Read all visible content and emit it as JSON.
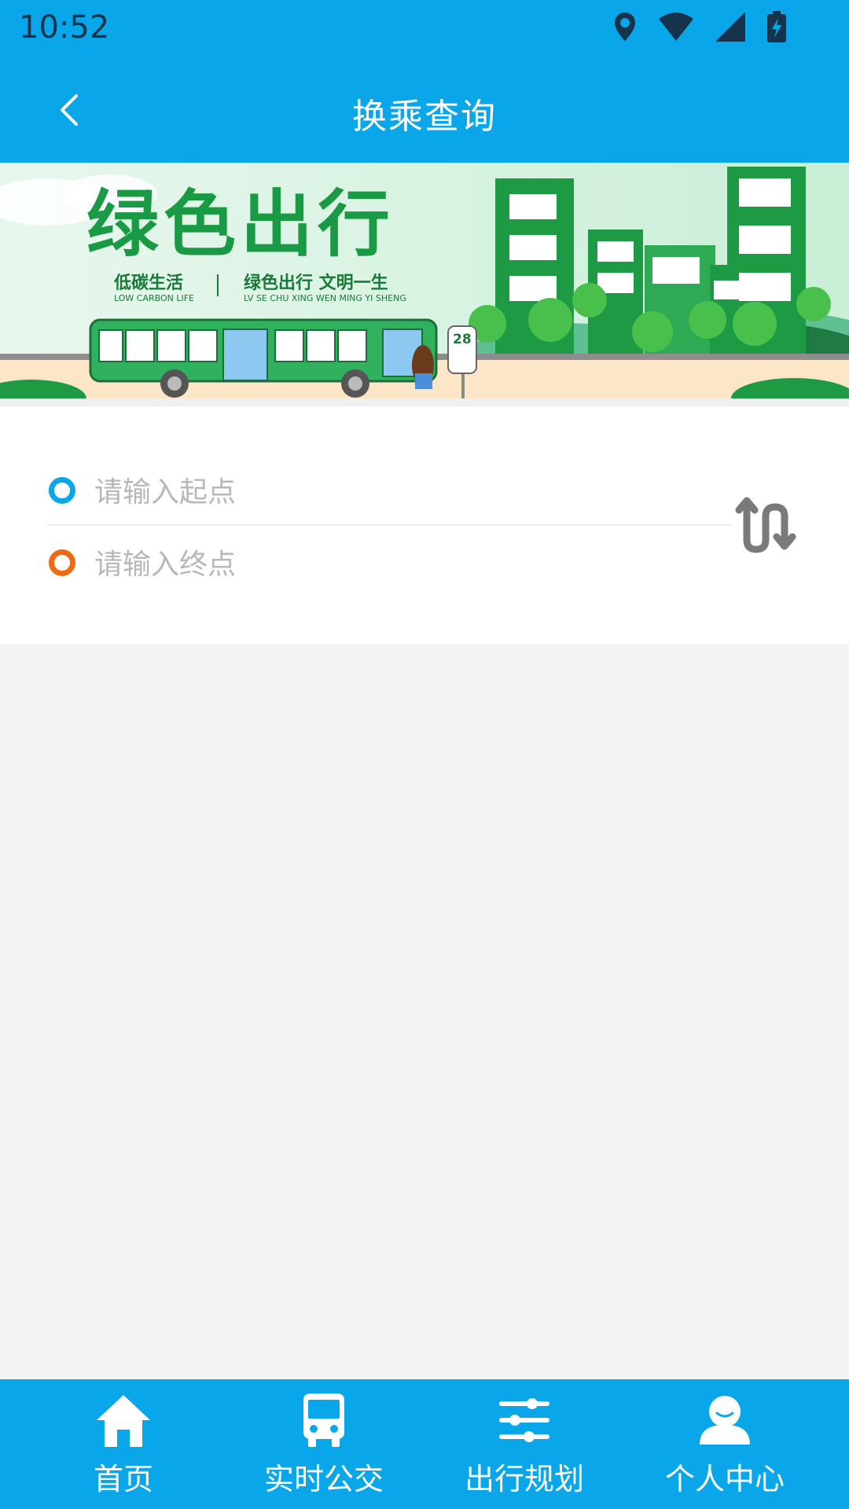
{
  "status_bar": {
    "time": "10:52",
    "icons": [
      "location-icon",
      "wifi-icon",
      "signal-icon",
      "battery-charging-icon"
    ]
  },
  "header": {
    "title": "换乘查询",
    "back_icon": "chevron-left-icon"
  },
  "banner": {
    "title": "绿色出行",
    "slogan_cn_left": "低碳生活",
    "slogan_cn_right": "绿色出行 文明一生",
    "slogan_en_left": "LOW CARBON LIFE",
    "slogan_en_right": "LV SE CHU XING  WEN MING YI SHENG",
    "bus_stop_number": "28"
  },
  "route_form": {
    "start_placeholder": "请输入起点",
    "end_placeholder": "请输入终点",
    "swap_icon": "swap-icon"
  },
  "tabbar": {
    "items": [
      {
        "label": "首页",
        "icon": "home-icon"
      },
      {
        "label": "实时公交",
        "icon": "bus-icon"
      },
      {
        "label": "出行规划",
        "icon": "sliders-icon"
      },
      {
        "label": "个人中心",
        "icon": "user-icon"
      }
    ]
  },
  "colors": {
    "primary": "#09a7ea",
    "start_dot": "#09a7ea",
    "end_dot": "#ef6a15",
    "banner_green": "#1a9a45"
  }
}
